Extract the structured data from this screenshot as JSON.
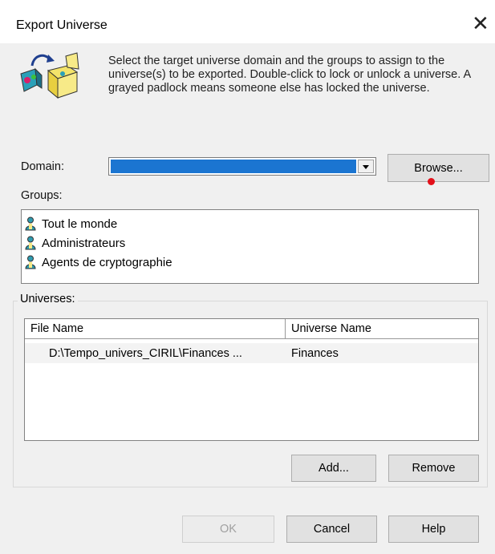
{
  "window": {
    "title": "Export Universe"
  },
  "instructions": "Select the target universe domain and the groups to assign to the universe(s) to be exported. Double-click to lock or unlock a universe. A grayed padlock means someone else has locked the universe.",
  "domain": {
    "label": "Domain:",
    "value": "",
    "browse_label": "Browse..."
  },
  "groups": {
    "label": "Groups:",
    "items": [
      {
        "name": "Tout le monde"
      },
      {
        "name": "Administrateurs"
      },
      {
        "name": "Agents de cryptographie"
      }
    ]
  },
  "universes": {
    "legend": "Universes:",
    "columns": [
      "File Name",
      "Universe Name"
    ],
    "rows": [
      {
        "file_name": "D:\\Tempo_univers_CIRIL\\Finances ...",
        "universe_name": "Finances"
      }
    ],
    "add_label": "Add...",
    "remove_label": "Remove"
  },
  "footer": {
    "ok_label": "OK",
    "cancel_label": "Cancel",
    "help_label": "Help"
  },
  "colors": {
    "selection": "#1b75d1",
    "accent_marker": "#e3101a",
    "group_icon": "#2f9bb0"
  }
}
